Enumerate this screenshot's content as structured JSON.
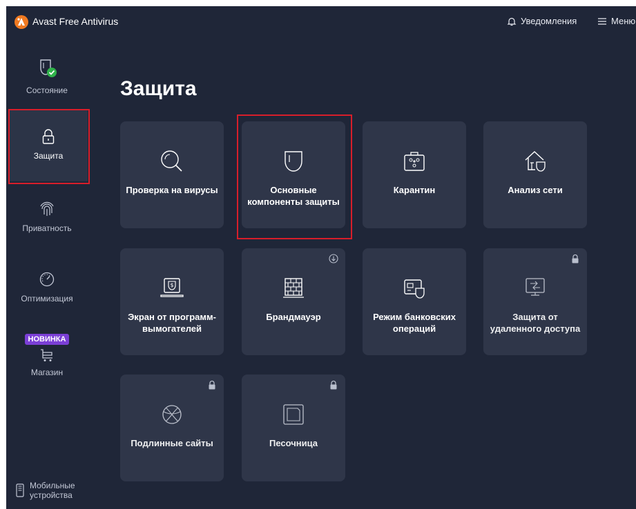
{
  "window": {
    "app_title": "Avast Free Antivirus",
    "notifications_label": "Уведомления",
    "menu_label": "Меню"
  },
  "sidebar": {
    "items": [
      {
        "label": "Состояние",
        "icon": "shield-check-icon"
      },
      {
        "label": "Защита",
        "icon": "lock-icon"
      },
      {
        "label": "Приватность",
        "icon": "fingerprint-icon"
      },
      {
        "label": "Оптимизация",
        "icon": "speedometer-icon"
      },
      {
        "label": "Магазин",
        "icon": "cart-icon",
        "badge": "НОВИНКА"
      }
    ],
    "mobile_label_line1": "Мобильные",
    "mobile_label_line2": "устройства"
  },
  "main": {
    "title": "Защита",
    "cards": [
      {
        "label": "Проверка на вирусы",
        "icon": "magnifier-icon"
      },
      {
        "label": "Основные компоненты защиты",
        "icon": "shield-icon"
      },
      {
        "label": "Карантин",
        "icon": "quarantine-case-icon"
      },
      {
        "label": "Анализ сети",
        "icon": "house-shield-icon"
      },
      {
        "label": "Экран от программ-вымогателей",
        "icon": "laptop-dollar-icon"
      },
      {
        "label": "Брандмауэр",
        "icon": "brick-wall-icon",
        "status_icon": "download-icon"
      },
      {
        "label": "Режим банковских операций",
        "icon": "bank-card-shield-icon"
      },
      {
        "label": "Защита от удаленного доступа",
        "icon": "monitor-arrows-icon",
        "status_icon": "lock-icon"
      },
      {
        "label": "Подлинные сайты",
        "icon": "globe-icon",
        "status_icon": "lock-icon"
      },
      {
        "label": "Песочница",
        "icon": "sandbox-icon",
        "status_icon": "lock-icon"
      }
    ]
  },
  "colors": {
    "background": "#1f2638",
    "card": "#2f3649",
    "selected_nav": "#2c3447",
    "highlight_border": "#d81e2a",
    "brand_orange": "#f07a21",
    "badge_purple": "#7b3fd6",
    "status_green": "#2fb34a"
  }
}
